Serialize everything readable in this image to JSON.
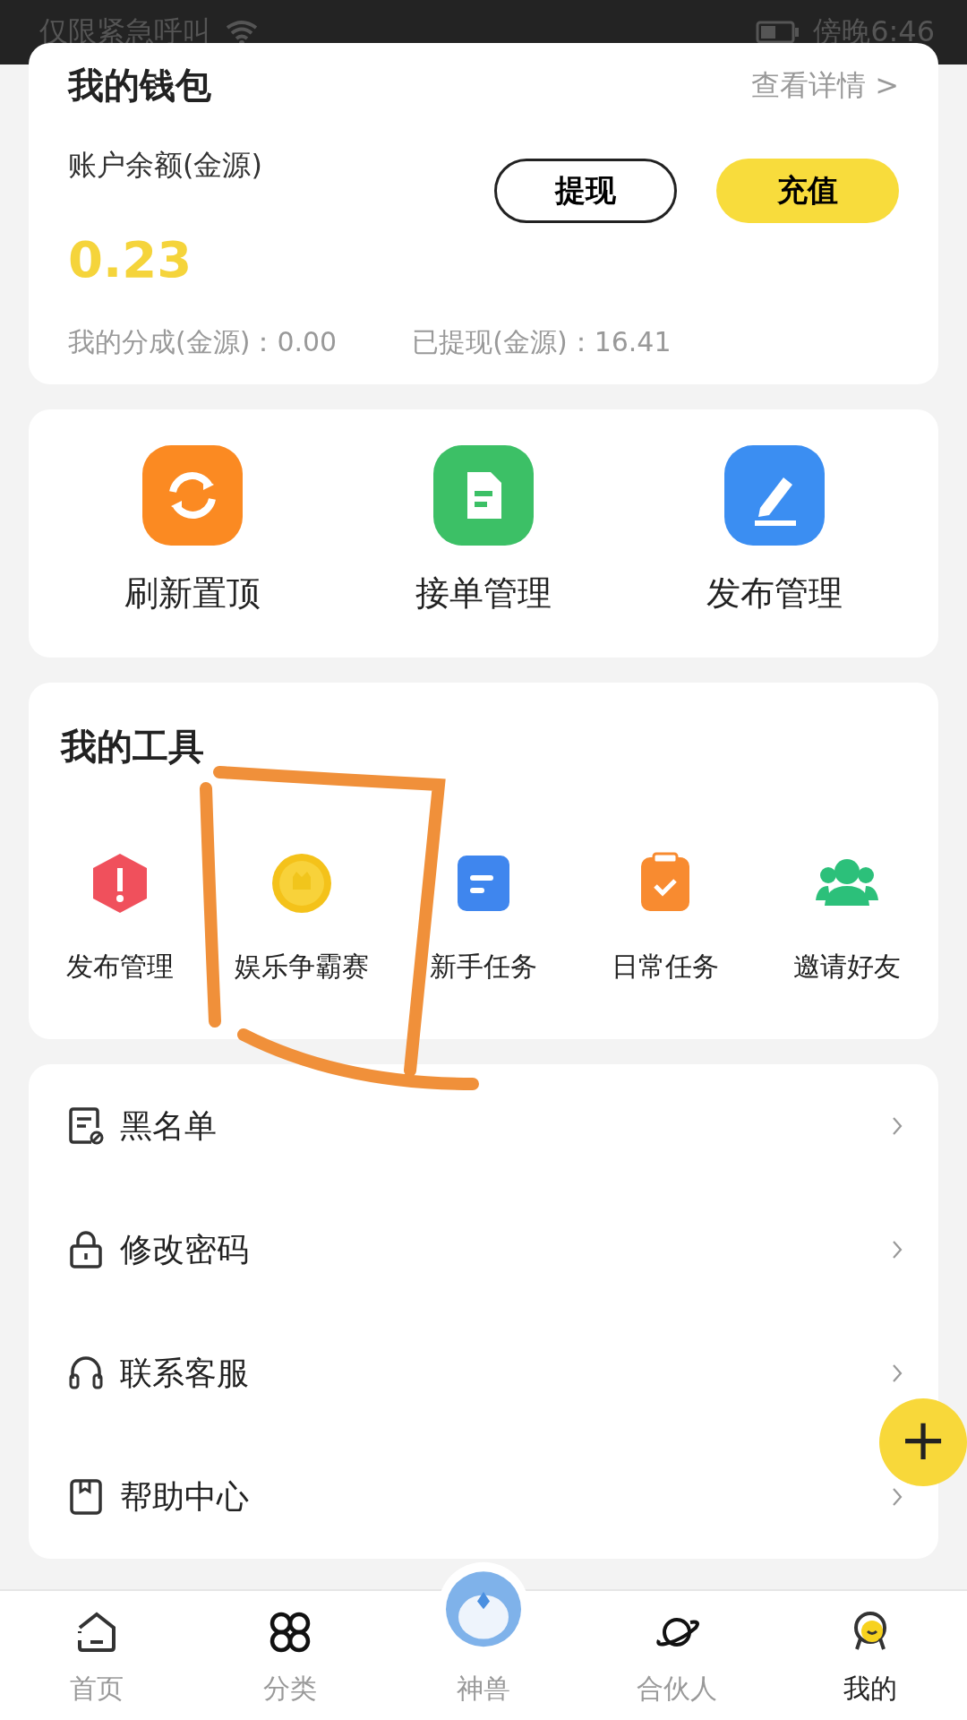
{
  "status_bar": {
    "carrier": "仅限紧急呼叫",
    "time": "傍晚6:46"
  },
  "wallet": {
    "title": "我的钱包",
    "details_link": "查看详情 >",
    "balance_label": "账户余额(金源)",
    "balance": "0.23",
    "withdraw_button": "提现",
    "recharge_button": "充值",
    "share": "我的分成(金源)：0.00",
    "withdrawn": "已提现(金源)：16.41"
  },
  "quick_actions": [
    {
      "kind": "refresh",
      "label": "刷新置顶"
    },
    {
      "kind": "orders",
      "label": "接单管理"
    },
    {
      "kind": "publish",
      "label": "发布管理"
    }
  ],
  "tools": {
    "title": "我的工具",
    "items": [
      {
        "kind": "alert",
        "label": "发布管理"
      },
      {
        "kind": "coin",
        "label": "娱乐争霸赛"
      },
      {
        "kind": "doc",
        "label": "新手任务"
      },
      {
        "kind": "clipboard",
        "label": "日常任务"
      },
      {
        "kind": "people",
        "label": "邀请好友"
      }
    ]
  },
  "menu": [
    {
      "kind": "blacklist",
      "label": "黑名单"
    },
    {
      "kind": "lock",
      "label": "修改密码"
    },
    {
      "kind": "headset",
      "label": "联系客服"
    },
    {
      "kind": "book",
      "label": "帮助中心"
    }
  ],
  "fab": {
    "label": "+"
  },
  "nav": [
    {
      "kind": "home",
      "label": "首页",
      "selected": false
    },
    {
      "kind": "grid",
      "label": "分类",
      "selected": false
    },
    {
      "kind": "mascot",
      "label": "神兽",
      "selected": false
    },
    {
      "kind": "planet",
      "label": "合伙人",
      "selected": false
    },
    {
      "kind": "me",
      "label": "我的",
      "selected": true
    }
  ]
}
